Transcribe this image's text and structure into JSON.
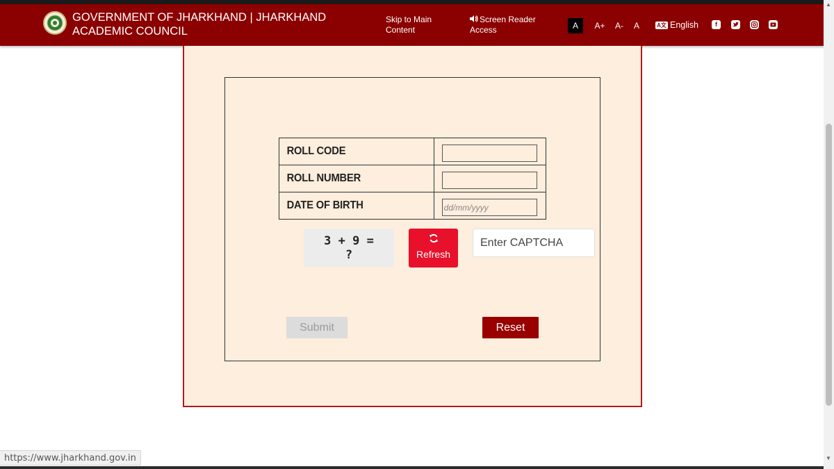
{
  "header": {
    "title": "GOVERNMENT OF JHARKHAND | JHARKHAND ACADEMIC COUNCIL",
    "skip_link": "Skip to Main Content",
    "screen_reader": "Screen Reader Access",
    "font_buttons": [
      "A",
      "A+",
      "A-",
      "A"
    ],
    "language": "English",
    "social": [
      "facebook-icon",
      "twitter-icon",
      "instagram-icon",
      "youtube-icon"
    ]
  },
  "form": {
    "rows": [
      {
        "label": "ROLL CODE",
        "placeholder": "",
        "value": ""
      },
      {
        "label": "ROLL NUMBER",
        "placeholder": "",
        "value": ""
      },
      {
        "label": "DATE OF BIRTH",
        "placeholder": "dd/mm/yyyy",
        "value": ""
      }
    ],
    "captcha_line1": "3 + 9 =",
    "captcha_line2": "?",
    "refresh_label": "Refresh",
    "captcha_placeholder": "Enter CAPTCHA",
    "submit_label": "Submit",
    "reset_label": "Reset"
  },
  "status_bar": {
    "url": "https://www.jharkhand.gov.in"
  },
  "colors": {
    "header_bg": "#8b0000",
    "panel_bg": "#fdeedd",
    "panel_border": "#b01a1a",
    "refresh_bg": "#e8102a",
    "reset_bg": "#990000",
    "submit_bg": "#dcdcdc"
  }
}
